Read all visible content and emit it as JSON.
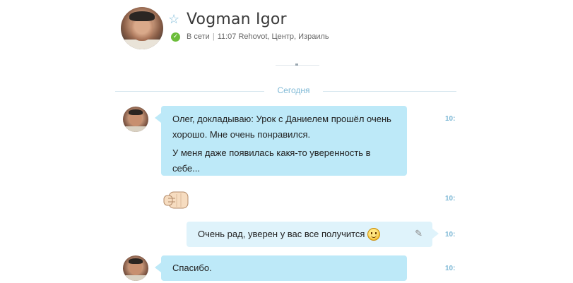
{
  "header": {
    "contact_name": "Vogman Igor",
    "status": "В сети",
    "separator": "|",
    "local_time_location": "11:07 Rehovot, Центр, Израиль",
    "favorite_icon": "star-icon",
    "status_icon": "online-check-icon"
  },
  "divider": {
    "date_label": "Сегодня"
  },
  "messages": [
    {
      "direction": "incoming",
      "paragraphs": [
        "Олег, докладываю: Урок с Даниелем прошёл очень хорошо. Мне очень понравился.",
        "У меня даже появилась какя-то уверенность в себе..."
      ],
      "time": "10:"
    },
    {
      "direction": "incoming",
      "emoticon": "fist-icon",
      "time": "10:"
    },
    {
      "direction": "outgoing",
      "text": "Очень рад, уверен у вас все получится",
      "emoticon": "smile-icon",
      "edit_icon": "pencil-icon",
      "time": "10:"
    },
    {
      "direction": "incoming",
      "text": "Спасибо.",
      "time": "10:"
    }
  ],
  "colors": {
    "incoming_bubble": "#bde9f8",
    "outgoing_bubble": "#dff3fb",
    "accent": "#7fb9d6",
    "online": "#6cbd3a"
  }
}
